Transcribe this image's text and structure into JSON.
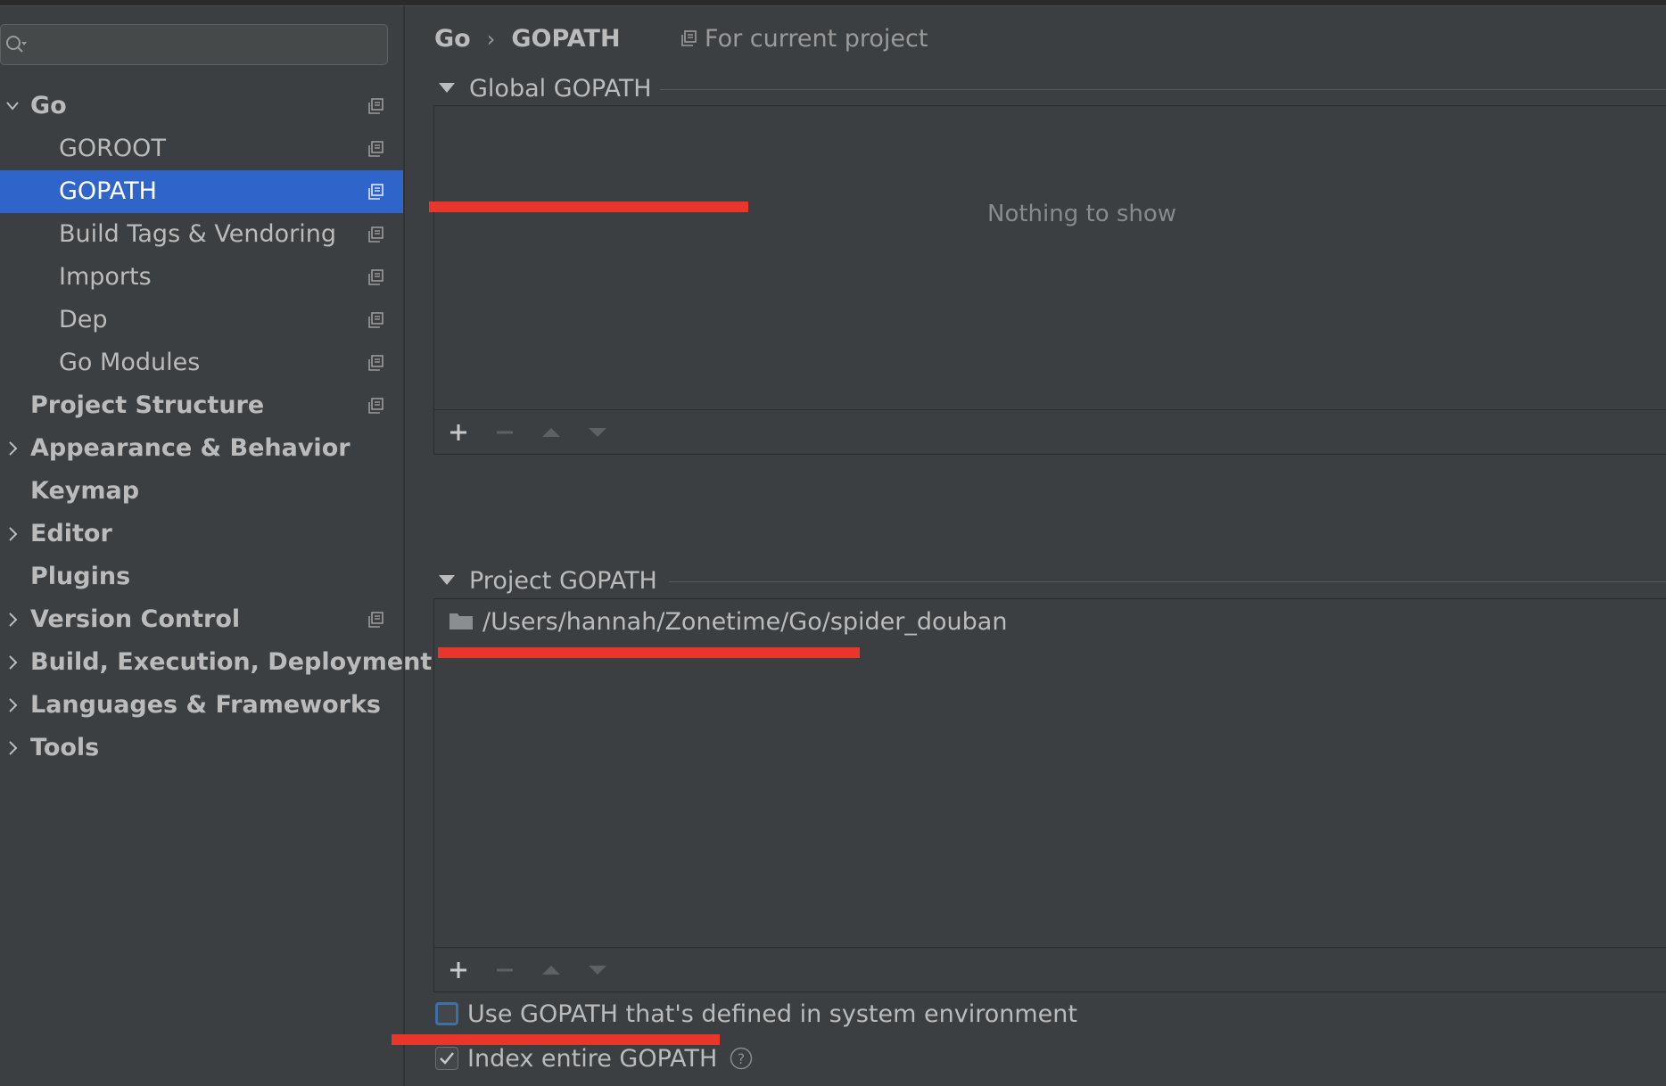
{
  "search": {
    "value": "",
    "placeholder": ""
  },
  "sidebar": {
    "items": [
      {
        "label": "Go",
        "level": 0,
        "bold": true,
        "expandable": true,
        "expanded": true,
        "project_icon": true,
        "selected": false
      },
      {
        "label": "GOROOT",
        "level": 1,
        "bold": false,
        "expandable": false,
        "project_icon": true,
        "selected": false
      },
      {
        "label": "GOPATH",
        "level": 1,
        "bold": false,
        "expandable": false,
        "project_icon": true,
        "selected": true
      },
      {
        "label": "Build Tags & Vendoring",
        "level": 1,
        "bold": false,
        "expandable": false,
        "project_icon": true,
        "selected": false
      },
      {
        "label": "Imports",
        "level": 1,
        "bold": false,
        "expandable": false,
        "project_icon": true,
        "selected": false
      },
      {
        "label": "Dep",
        "level": 1,
        "bold": false,
        "expandable": false,
        "project_icon": true,
        "selected": false
      },
      {
        "label": "Go Modules",
        "level": 1,
        "bold": false,
        "expandable": false,
        "project_icon": true,
        "selected": false
      },
      {
        "label": "Project Structure",
        "level": 0,
        "bold": true,
        "expandable": false,
        "project_icon": true,
        "selected": false
      },
      {
        "label": "Appearance & Behavior",
        "level": 0,
        "bold": true,
        "expandable": true,
        "expanded": false,
        "project_icon": false,
        "selected": false
      },
      {
        "label": "Keymap",
        "level": 0,
        "bold": true,
        "expandable": false,
        "project_icon": false,
        "selected": false
      },
      {
        "label": "Editor",
        "level": 0,
        "bold": true,
        "expandable": true,
        "expanded": false,
        "project_icon": false,
        "selected": false
      },
      {
        "label": "Plugins",
        "level": 0,
        "bold": true,
        "expandable": false,
        "project_icon": false,
        "selected": false
      },
      {
        "label": "Version Control",
        "level": 0,
        "bold": true,
        "expandable": true,
        "expanded": false,
        "project_icon": true,
        "selected": false
      },
      {
        "label": "Build, Execution, Deployment",
        "level": 0,
        "bold": true,
        "expandable": true,
        "expanded": false,
        "project_icon": false,
        "selected": false
      },
      {
        "label": "Languages & Frameworks",
        "level": 0,
        "bold": true,
        "expandable": true,
        "expanded": false,
        "project_icon": false,
        "selected": false
      },
      {
        "label": "Tools",
        "level": 0,
        "bold": true,
        "expandable": true,
        "expanded": false,
        "project_icon": false,
        "selected": false
      }
    ]
  },
  "header": {
    "breadcrumb": [
      "Go",
      "GOPATH"
    ],
    "separator": "›",
    "scope_label": "For current project"
  },
  "global_gopath": {
    "title": "Global GOPATH",
    "empty_text": "Nothing to show",
    "entries": []
  },
  "project_gopath": {
    "title": "Project GOPATH",
    "entries": [
      "/Users/hannah/Zonetime/Go/spider_douban"
    ]
  },
  "options": {
    "use_system_env": {
      "label": "Use GOPATH that's defined in system environment",
      "checked": false
    },
    "index_entire": {
      "label": "Index entire GOPATH",
      "checked": true
    }
  },
  "colors": {
    "background": "#3c3f41",
    "selection": "#2f65ca",
    "annotation_red": "#e8362a",
    "text": "#bbbbbb"
  }
}
